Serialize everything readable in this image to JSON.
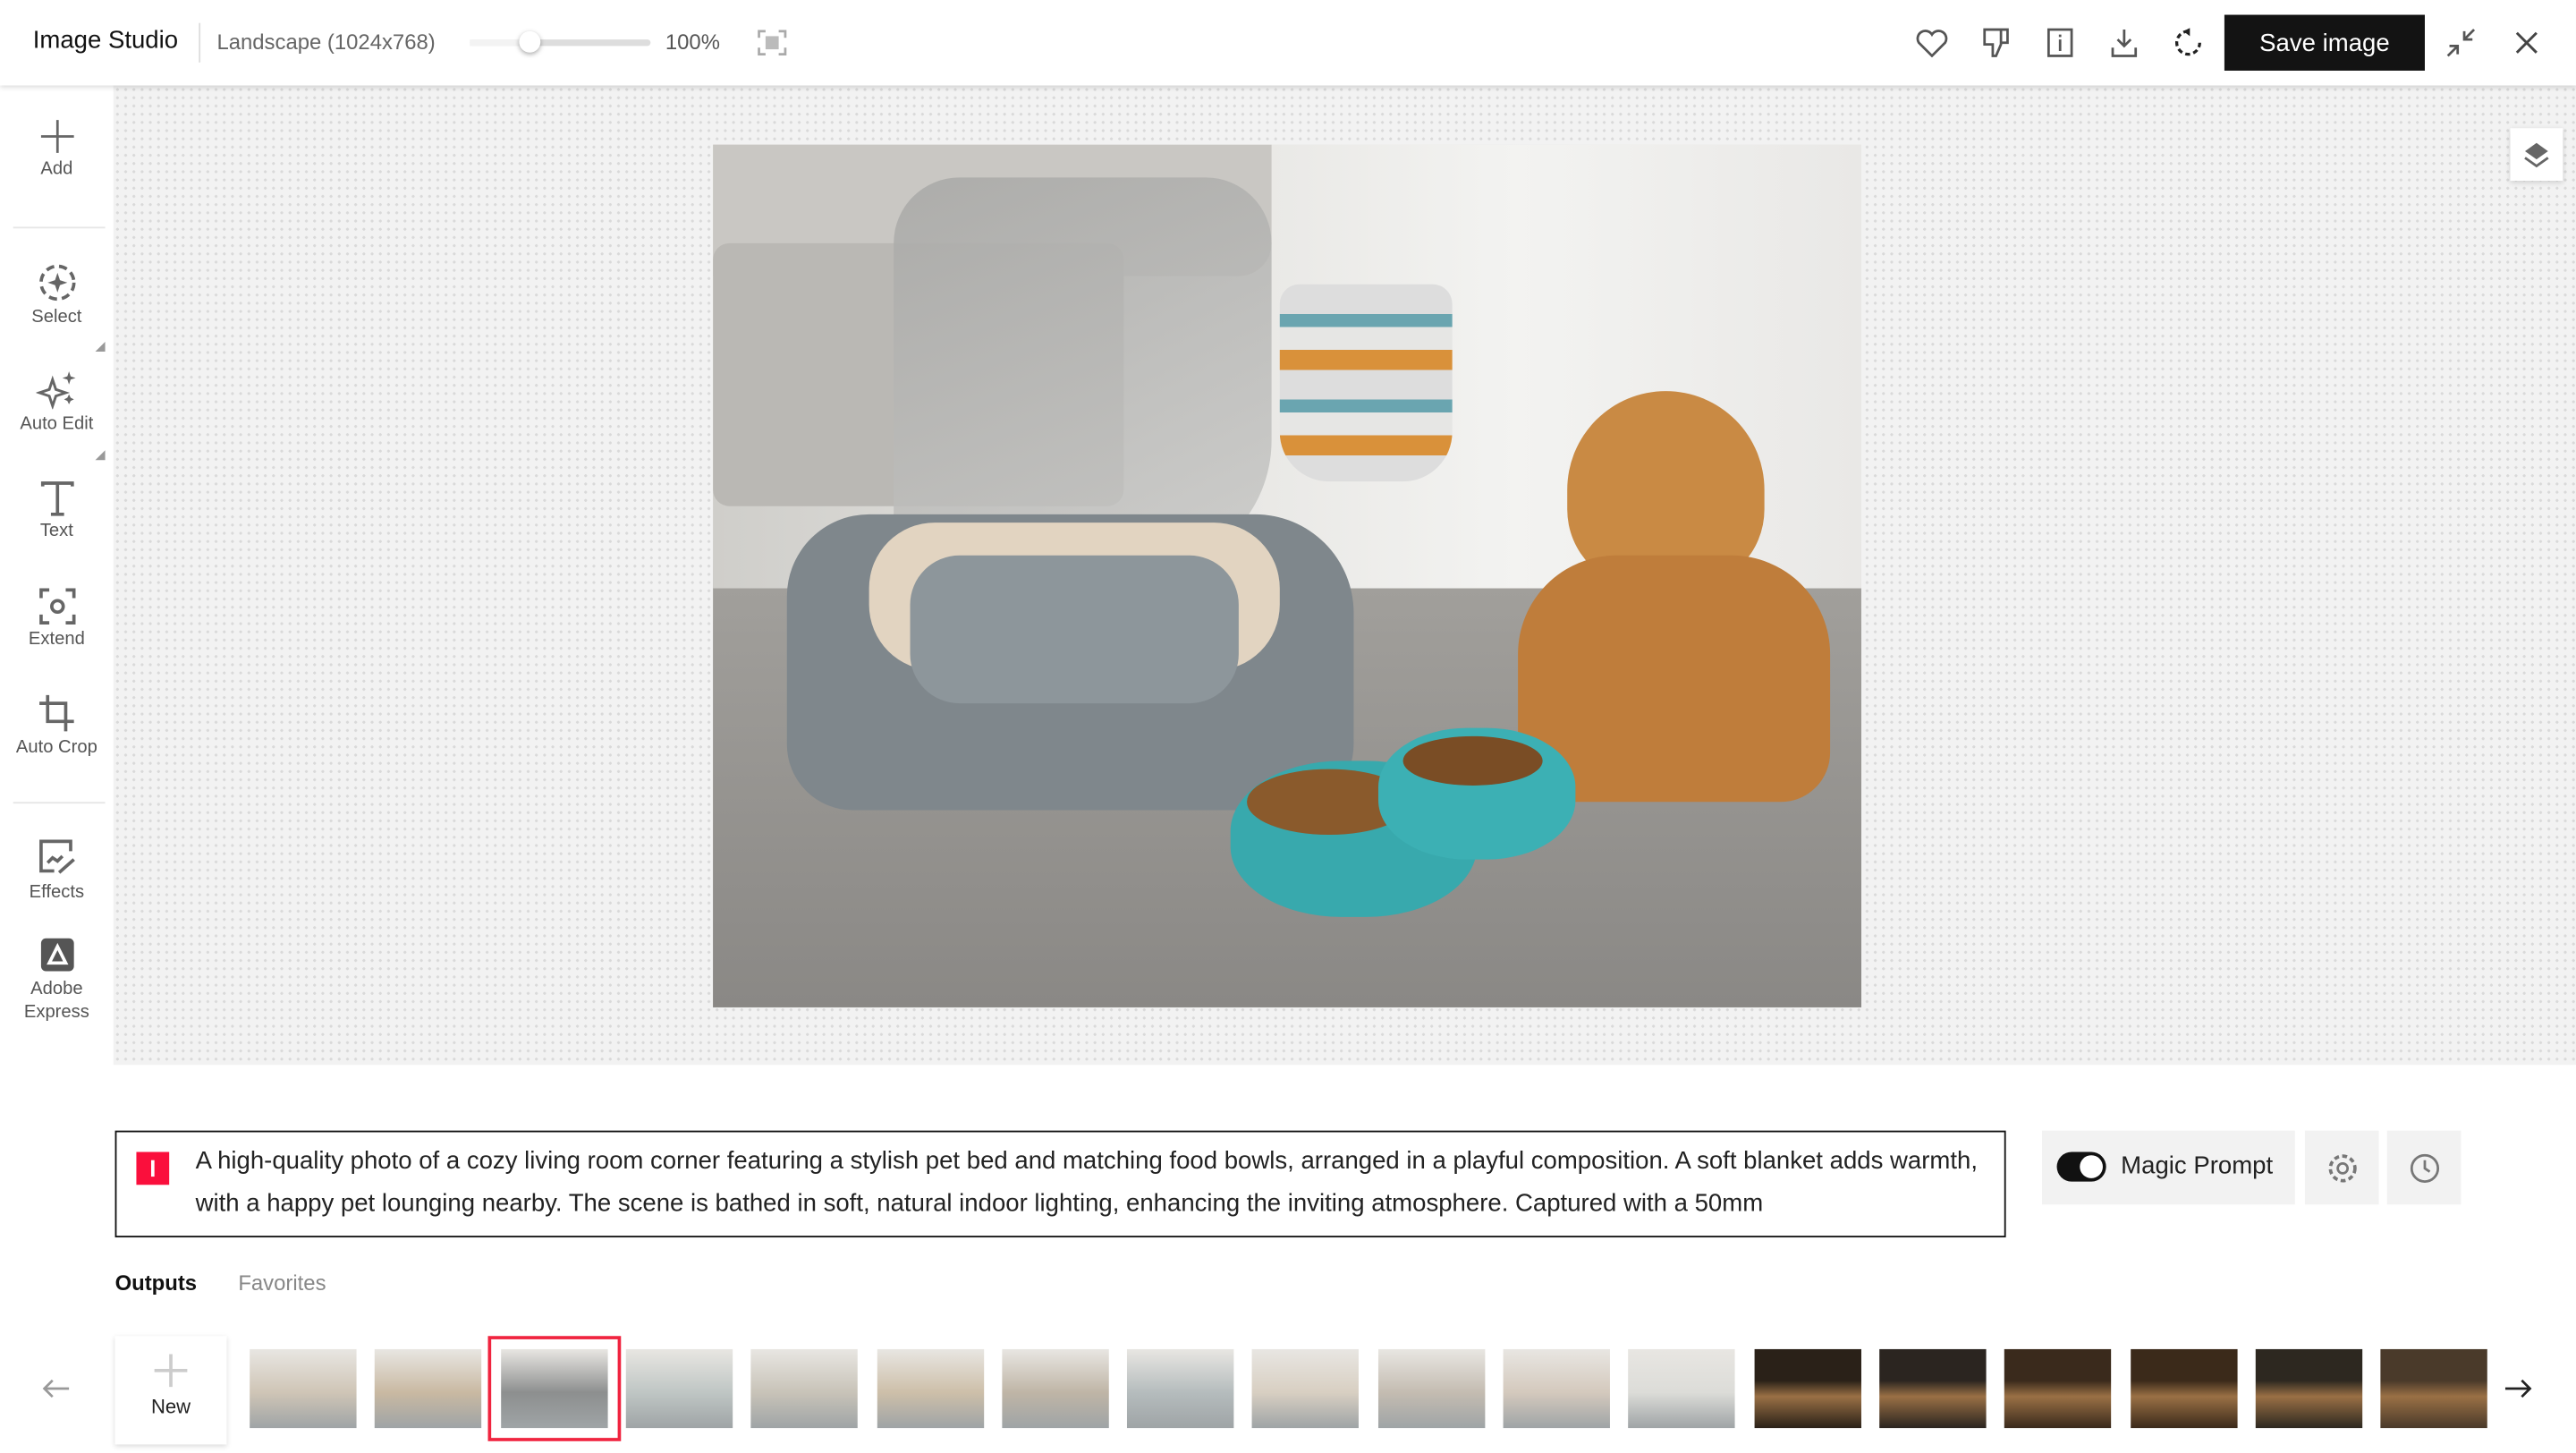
{
  "header": {
    "app_title": "Image Studio",
    "preset": "Landscape (1024x768)",
    "zoom_level": "100%",
    "zoom_slider_fraction": 0.3,
    "save_label": "Save image",
    "icons": [
      "fit-screen-icon",
      "heart-icon",
      "thumbs-down-icon",
      "info-icon",
      "download-icon",
      "regenerate-icon",
      "collapse-icon",
      "close-icon"
    ]
  },
  "sidebar": {
    "items": [
      {
        "label": "Add",
        "icon": "plus-icon"
      },
      {
        "label": "Select",
        "icon": "select-icon"
      },
      {
        "label": "Auto Edit",
        "icon": "sparkles-icon"
      },
      {
        "label": "Text",
        "icon": "text-icon"
      },
      {
        "label": "Extend",
        "icon": "extend-icon"
      },
      {
        "label": "Auto Crop",
        "icon": "crop-icon"
      },
      {
        "label": "Effects",
        "icon": "effects-icon"
      },
      {
        "label": "Adobe Express",
        "icon": "adobe-express-icon"
      }
    ]
  },
  "prompt": {
    "text": "A high-quality photo of a cozy living room corner featuring a stylish pet bed and matching food bowls, arranged in a playful composition. A soft blanket adds warmth, with a happy pet lounging nearby. The scene is bathed in soft, natural indoor lighting, enhancing the inviting atmosphere. Captured with a 50mm",
    "magic_prompt_label": "Magic Prompt",
    "magic_prompt_on": true
  },
  "outputs": {
    "tabs": [
      {
        "label": "Outputs",
        "active": true
      },
      {
        "label": "Favorites",
        "active": false
      }
    ],
    "new_label": "New",
    "selected_index": 2,
    "thumb_colors": [
      "#cfc5b6",
      "#c9b9a2",
      "#8d8f8f",
      "#bfc6c4",
      "#c8c3b8",
      "#cdbfa9",
      "#bfb5a6",
      "#b5bcbd",
      "#d8cfc2",
      "#c4bcb1",
      "#d4c9bd",
      "#dcdcd8",
      "#2a2118",
      "#2b2520",
      "#3a2a1c",
      "#3b2a1a",
      "#2d2820",
      "#4a3a2a"
    ],
    "accent_color": "#f0243f"
  }
}
